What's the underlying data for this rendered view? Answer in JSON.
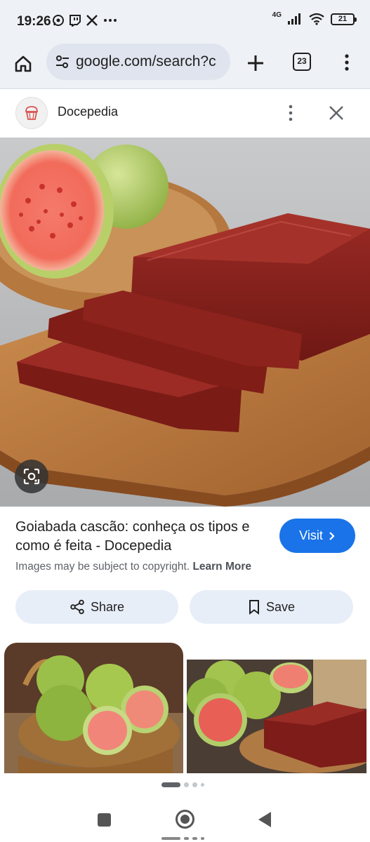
{
  "status_bar": {
    "time": "19:26",
    "left_icons": [
      "whatsapp-icon",
      "twitch-icon",
      "x-icon",
      "more-dots-icon"
    ],
    "network": "4G",
    "battery": "21"
  },
  "browser": {
    "url": "google.com/search?c",
    "tab_count": "23"
  },
  "panel": {
    "site_name": "Docepedia"
  },
  "result": {
    "title": "Goiabada cascão: conheça os tipos e como é feita - Docepedia",
    "visit_label": "Visit",
    "copyright_text": "Images may be subject to copyright.",
    "learn_more": "Learn More",
    "share_label": "Share",
    "save_label": "Save"
  },
  "pager": {
    "pages": 4,
    "active_index": 0
  },
  "colors": {
    "accent": "#1a73e8",
    "chrome_bg": "#eef1f6",
    "pill_bg": "#e8eef8"
  }
}
